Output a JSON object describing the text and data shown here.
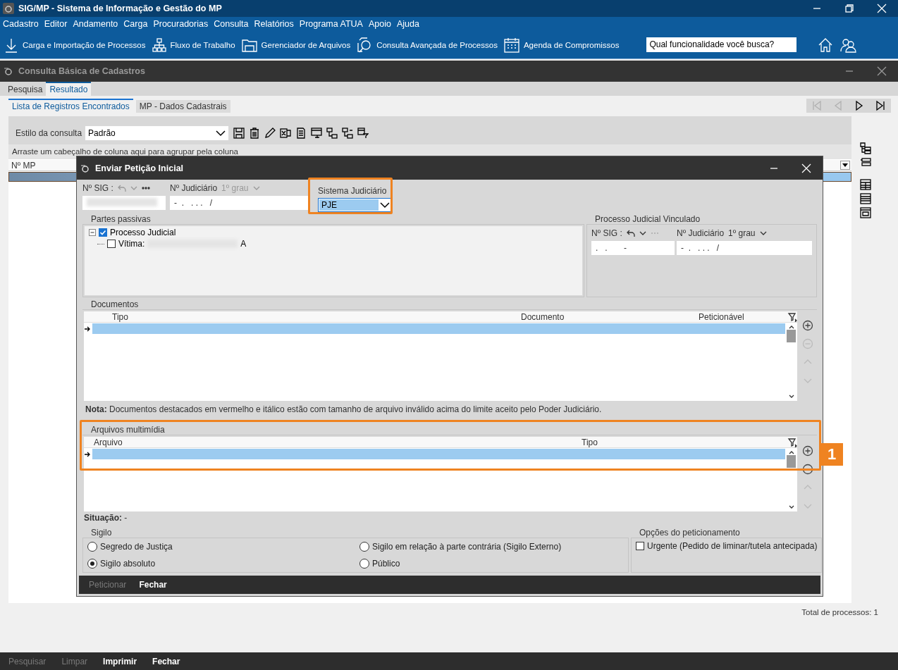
{
  "app_window": {
    "title": "SIG/MP - Sistema de Informação e Gestão do MP"
  },
  "menu": [
    "Cadastro",
    "Editor",
    "Andamento",
    "Carga",
    "Procuradorias",
    "Consulta",
    "Relatórios",
    "Programa ATUA",
    "Apoio",
    "Ajuda"
  ],
  "toolbar": [
    {
      "kind": "download",
      "label": "Carga e Importação de Processos"
    },
    {
      "kind": "flow",
      "label": "Fluxo de Trabalho"
    },
    {
      "kind": "folder",
      "label": "Gerenciador de Arquivos"
    },
    {
      "kind": "search",
      "label": "Consulta Avançada de Processos"
    },
    {
      "kind": "calendar",
      "label": "Agenda de Compromissos"
    }
  ],
  "search": {
    "placeholder": "Qual funcionalidade você busca?"
  },
  "inner_window": {
    "title": "Consulta Básica de Cadastros"
  },
  "tabs": [
    {
      "label": "Pesquisa",
      "selected": false
    },
    {
      "label": "Resultado",
      "selected": true
    }
  ],
  "subtabs": [
    {
      "label": "Lista de Registros Encontrados",
      "selected": true
    },
    {
      "label": "MP - Dados Cadastrais",
      "selected": false
    }
  ],
  "pager": [
    {
      "kind": "first",
      "disabled": true
    },
    {
      "kind": "prev",
      "disabled": true
    },
    {
      "kind": "next",
      "disabled": false
    },
    {
      "kind": "last",
      "disabled": false
    }
  ],
  "query_style": {
    "label": "Estilo da consulta",
    "value": "Padrão"
  },
  "grid": {
    "group_hint": "Arraste um cabeçalho de coluna aqui para agrupar pela coluna",
    "columns": [
      "Nº MP"
    ]
  },
  "total": "Total de processos: 1",
  "bottom_buttons": [
    {
      "label": "Pesquisar",
      "disabled": true
    },
    {
      "label": "Limpar",
      "disabled": true
    },
    {
      "label": "Imprimir",
      "disabled": false
    },
    {
      "label": "Fechar",
      "disabled": false
    }
  ],
  "dialog": {
    "title": "Enviar Petição Inicial",
    "sig_label": "Nº SIG :",
    "judicial_label": "Nº Judiciário",
    "degree": "1º grau",
    "judicial_value": "-  .   . . .   /",
    "system": {
      "label": "Sistema Judiciário",
      "value": "PJE"
    },
    "passive": {
      "title": "Partes passivas",
      "tree": [
        {
          "label": "Processo Judicial",
          "checked": true,
          "expanded": true,
          "children": [
            {
              "label": "Vítima:",
              "checked": false,
              "tail": "A"
            }
          ]
        }
      ]
    },
    "linked": {
      "title": "Processo Judicial Vinculado",
      "sig_label": "Nº SIG :",
      "sig_value": ".   .       -",
      "judicial_label": "Nº Judiciário",
      "degree": "1º grau",
      "judicial_value": "-  .   . . .   /"
    },
    "documents": {
      "title": "Documentos",
      "columns": [
        "Tipo",
        "Documento",
        "Peticionável"
      ],
      "side_buttons": [
        {
          "kind": "add",
          "disabled": false
        },
        {
          "kind": "remove",
          "disabled": true
        },
        {
          "kind": "up",
          "disabled": true
        },
        {
          "kind": "down",
          "disabled": true
        }
      ]
    },
    "note": "**Nota:** Documentos destacados em vermelho e itálico estão com tamanho de arquivo inválido acima do limite aceito pelo Poder Judiciário.",
    "media": {
      "title": "Arquivos multimídia",
      "columns": [
        "Arquivo",
        "Tipo"
      ],
      "side_buttons": [
        {
          "kind": "add",
          "disabled": false
        },
        {
          "kind": "remove",
          "disabled": false
        },
        {
          "kind": "up",
          "disabled": true
        },
        {
          "kind": "down",
          "disabled": true
        }
      ]
    },
    "status": "**Situação:** -",
    "secrecy": {
      "title": "Sigilo",
      "options": [
        {
          "label": "Segredo de Justiça",
          "selected": false
        },
        {
          "label": "Sigilo em relação à parte contrária (Sigilo Externo)",
          "selected": false
        },
        {
          "label": "Sigilo absoluto",
          "selected": true
        },
        {
          "label": "Público",
          "selected": false
        }
      ]
    },
    "options": {
      "title": "Opções do peticionamento",
      "items": [
        {
          "label": "Urgente (Pedido de liminar/tutela antecipada)",
          "checked": false
        }
      ]
    },
    "buttons": [
      {
        "label": "Peticionar",
        "disabled": true
      },
      {
        "label": "Fechar",
        "disabled": false
      }
    ]
  },
  "callout": {
    "label": "1"
  }
}
